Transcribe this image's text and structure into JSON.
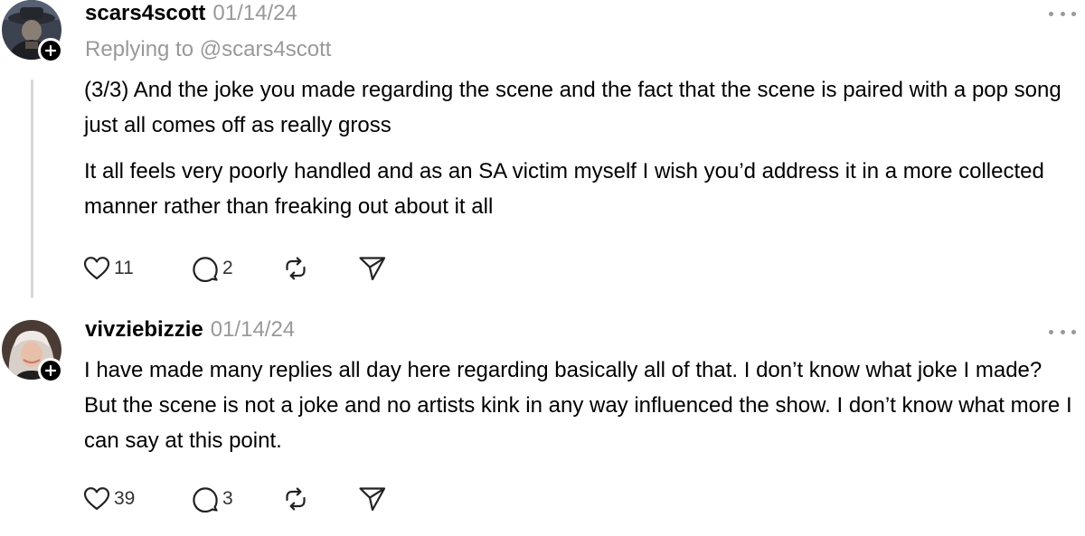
{
  "posts": [
    {
      "username": "scars4scott",
      "date": "01/14/24",
      "replying_to": "Replying to @scars4scott",
      "paragraphs": [
        "(3/3) And the joke you made regarding the scene and the fact that the scene is paired with a pop song just all comes off as really gross",
        "It all feels very poorly handled and as an SA victim myself I wish you’d address it in a more collected manner rather than freaking out about it all"
      ],
      "likes": "11",
      "replies": "2"
    },
    {
      "username": "vivziebizzie",
      "date": "01/14/24",
      "paragraphs": [
        "I have made many replies all day here regarding basically all of that. I don’t know what joke I made? But the scene is not a joke and no artists kink in any way influenced the show. I don’t know what more I can say at this point."
      ],
      "likes": "39",
      "replies": "3"
    }
  ],
  "icons": {
    "like": "heart-icon",
    "reply": "speech-bubble-icon",
    "repost": "repost-icon",
    "share": "send-icon",
    "more": "more-options-icon",
    "follow": "plus-icon"
  },
  "colors": {
    "text": "#000000",
    "secondary": "#999999",
    "thread_line": "#d8d8d8"
  }
}
